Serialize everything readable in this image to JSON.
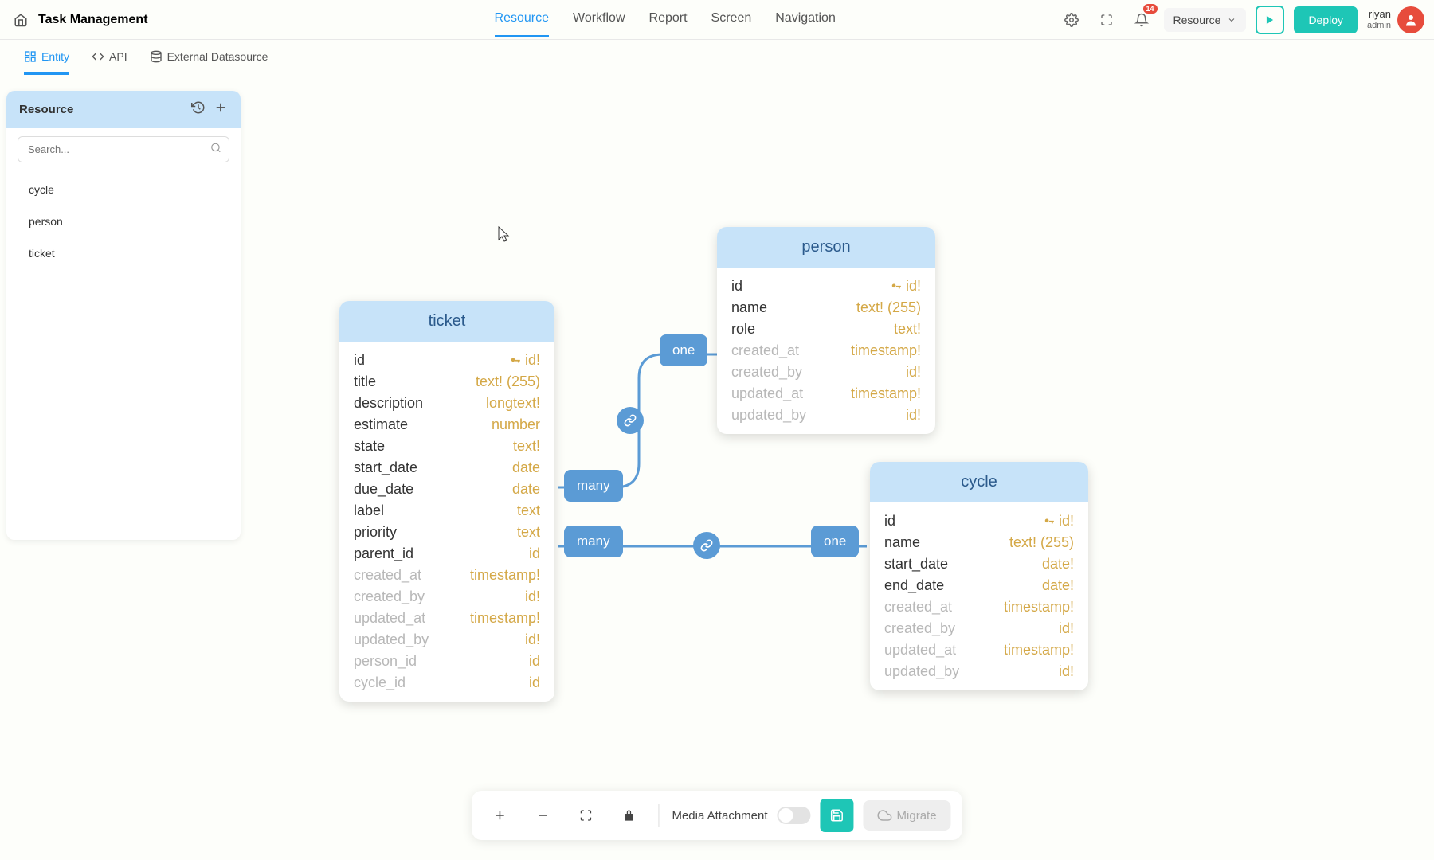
{
  "app_title": "Task Management",
  "main_nav": [
    "Resource",
    "Workflow",
    "Report",
    "Screen",
    "Navigation"
  ],
  "main_nav_active": 0,
  "sub_nav": [
    {
      "label": "Entity",
      "icon": "entity"
    },
    {
      "label": "API",
      "icon": "api"
    },
    {
      "label": "External Datasource",
      "icon": "db"
    }
  ],
  "sub_nav_active": 0,
  "notif_count": "14",
  "resource_dd": "Resource",
  "deploy_label": "Deploy",
  "user": {
    "name": "riyan",
    "role": "admin"
  },
  "sidebar": {
    "title": "Resource",
    "search_placeholder": "Search...",
    "items": [
      "cycle",
      "person",
      "ticket"
    ]
  },
  "entities": {
    "ticket": {
      "title": "ticket",
      "fields": [
        {
          "name": "id",
          "type": "id!",
          "pk": true
        },
        {
          "name": "title",
          "type": "text! (255)"
        },
        {
          "name": "description",
          "type": "longtext!"
        },
        {
          "name": "estimate",
          "type": "number"
        },
        {
          "name": "state",
          "type": "text!"
        },
        {
          "name": "start_date",
          "type": "date"
        },
        {
          "name": "due_date",
          "type": "date"
        },
        {
          "name": "label",
          "type": "text"
        },
        {
          "name": "priority",
          "type": "text"
        },
        {
          "name": "parent_id",
          "type": "id"
        },
        {
          "name": "created_at",
          "type": "timestamp!",
          "muted": true
        },
        {
          "name": "created_by",
          "type": "id!",
          "muted": true
        },
        {
          "name": "updated_at",
          "type": "timestamp!",
          "muted": true
        },
        {
          "name": "updated_by",
          "type": "id!",
          "muted": true
        },
        {
          "name": "person_id",
          "type": "id",
          "muted": true
        },
        {
          "name": "cycle_id",
          "type": "id",
          "muted": true
        }
      ]
    },
    "person": {
      "title": "person",
      "fields": [
        {
          "name": "id",
          "type": "id!",
          "pk": true
        },
        {
          "name": "name",
          "type": "text! (255)"
        },
        {
          "name": "role",
          "type": "text!"
        },
        {
          "name": "created_at",
          "type": "timestamp!",
          "muted": true
        },
        {
          "name": "created_by",
          "type": "id!",
          "muted": true
        },
        {
          "name": "updated_at",
          "type": "timestamp!",
          "muted": true
        },
        {
          "name": "updated_by",
          "type": "id!",
          "muted": true
        }
      ]
    },
    "cycle": {
      "title": "cycle",
      "fields": [
        {
          "name": "id",
          "type": "id!",
          "pk": true
        },
        {
          "name": "name",
          "type": "text! (255)"
        },
        {
          "name": "start_date",
          "type": "date!"
        },
        {
          "name": "end_date",
          "type": "date!"
        },
        {
          "name": "created_at",
          "type": "timestamp!",
          "muted": true
        },
        {
          "name": "created_by",
          "type": "id!",
          "muted": true
        },
        {
          "name": "updated_at",
          "type": "timestamp!",
          "muted": true
        },
        {
          "name": "updated_by",
          "type": "id!",
          "muted": true
        }
      ]
    }
  },
  "relations": {
    "many1": "many",
    "one1": "one",
    "many2": "many",
    "one2": "one"
  },
  "bottom": {
    "media_label": "Media Attachment",
    "migrate_label": "Migrate"
  }
}
